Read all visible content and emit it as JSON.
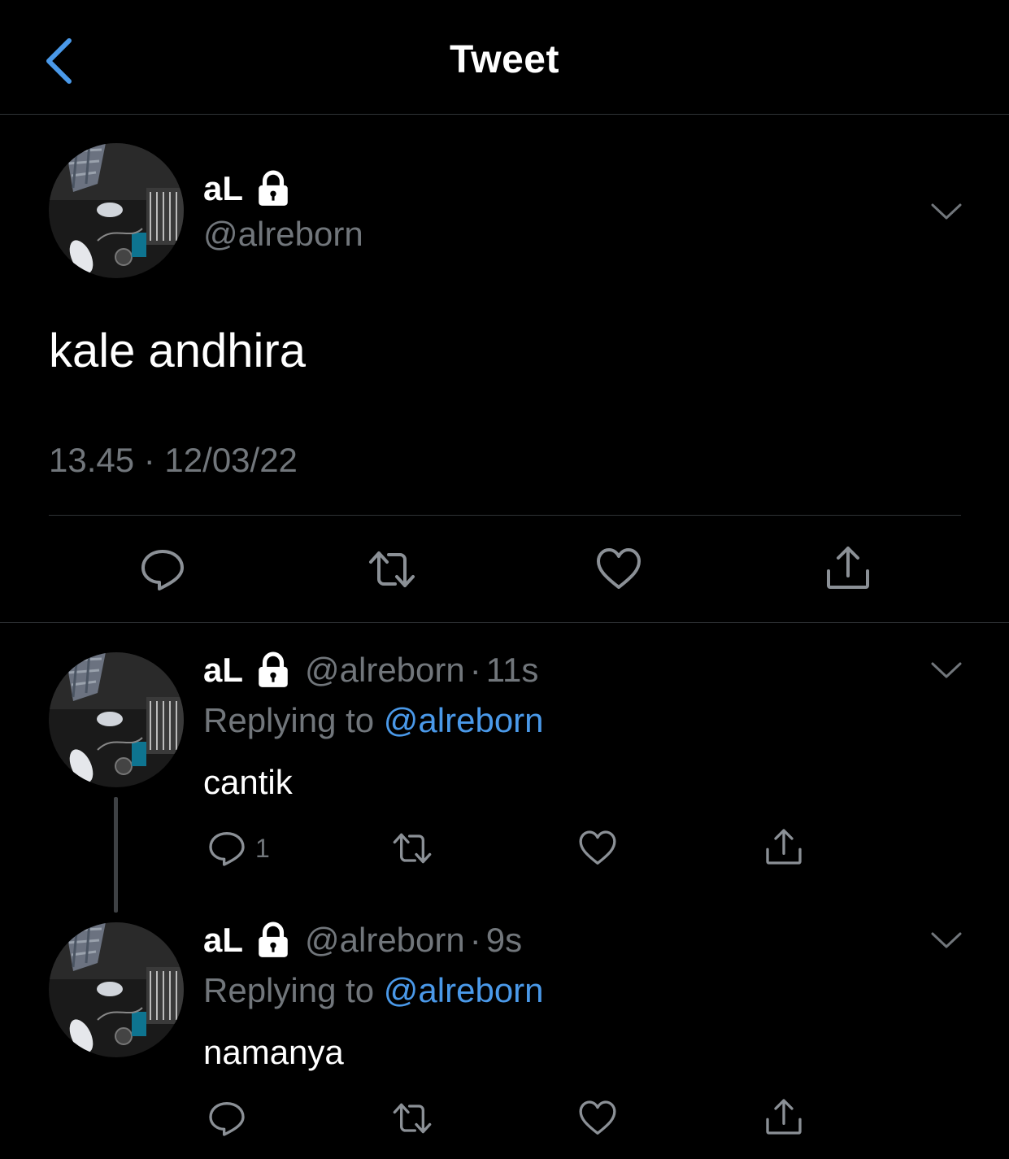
{
  "header": {
    "title": "Tweet"
  },
  "main_tweet": {
    "name": "aL",
    "handle": "@alreborn",
    "text": "kale andhira",
    "timestamp": "13.45 · 12/03/22"
  },
  "replies": [
    {
      "name": "aL",
      "handle": "@alreborn",
      "sep": "·",
      "time": "11s",
      "replying_prefix": "Replying to ",
      "replying_to": "@alreborn",
      "text": "cantik",
      "reply_count": "1"
    },
    {
      "name": "aL",
      "handle": "@alreborn",
      "sep": "·",
      "time": "9s",
      "replying_prefix": "Replying to ",
      "replying_to": "@alreborn",
      "text": "namanya",
      "reply_count": ""
    }
  ],
  "icons": [
    "back-chevron-icon",
    "lock-icon",
    "chevron-down-icon",
    "reply-icon",
    "retweet-icon",
    "like-icon",
    "share-icon"
  ],
  "colors": {
    "background": "#000000",
    "text": "#ffffff",
    "secondary": "#71767b",
    "accent": "#4a99e9",
    "divider": "#2f3336"
  }
}
